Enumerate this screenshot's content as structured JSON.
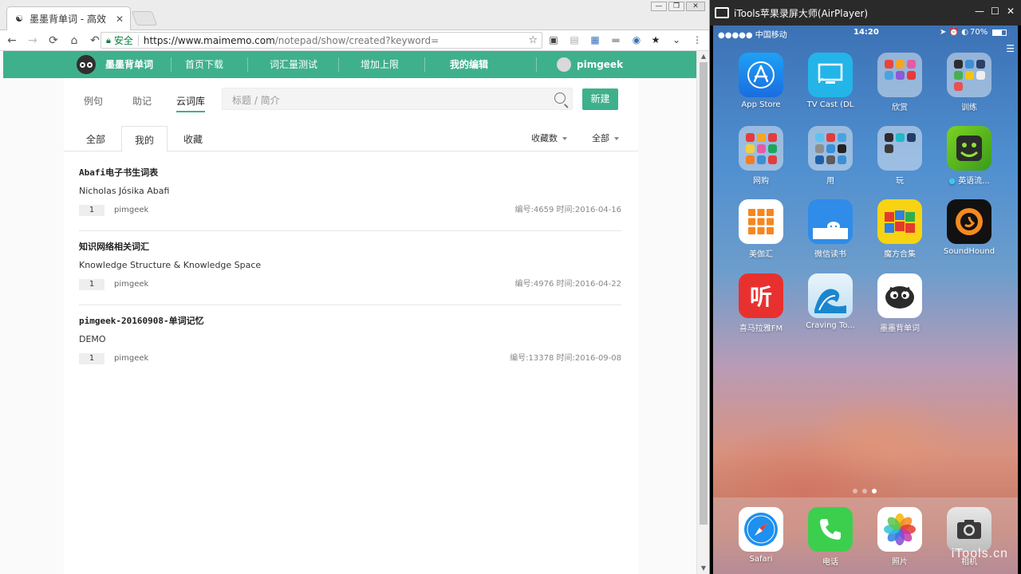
{
  "browser": {
    "tab_title": "墨墨背单词 - 高效",
    "tab_close": "✕",
    "window_controls": {
      "minimize": "—",
      "restore": "❐",
      "close": "✕"
    },
    "nav": {
      "back": "←",
      "forward": "→",
      "reload": "⟳",
      "home": "⌂",
      "undo": "↶"
    },
    "security_label": "安全",
    "url_host": "https://www.maimemo.com",
    "url_path": "/notepad/show/created?keyword=",
    "star": "☆"
  },
  "site": {
    "brand": "墨墨背单词",
    "nav_items": [
      "首页下载",
      "词汇量测试",
      "增加上限",
      "我的编辑"
    ],
    "user": "pimgeek",
    "subtabs": [
      "例句",
      "助记",
      "云词库"
    ],
    "active_subtab": "云词库",
    "search_placeholder": "标题 / 简介",
    "new_button": "新建",
    "filter_tabs": [
      "全部",
      "我的",
      "收藏"
    ],
    "sort_by": "收藏数",
    "range": "全部",
    "entries": [
      {
        "title": "Abafi电子书生词表",
        "subtitle": "Nicholas Jósika Abafi",
        "count": "1",
        "author": "pimgeek",
        "meta": "编号:4659  时间:2016-04-16"
      },
      {
        "title": "知识网络相关词汇",
        "subtitle": "Knowledge Structure & Knowledge Space",
        "count": "1",
        "author": "pimgeek",
        "meta": "编号:4976  时间:2016-04-22"
      },
      {
        "title": "pimgeek-20160908-单词记忆",
        "subtitle": "DEMO",
        "count": "1",
        "author": "pimgeek",
        "meta": "编号:13378  时间:2016-09-08"
      }
    ]
  },
  "itools": {
    "window_title": "iTools苹果录屏大师(AirPlayer)",
    "controls": {
      "minimize": "—",
      "restore": "☐",
      "close": "✕"
    },
    "status": {
      "carrier": "●●●●● 中国移动",
      "time": "14:20",
      "battery": "70%"
    },
    "apps": [
      {
        "label": "App Store"
      },
      {
        "label": "TV Cast (DL"
      },
      {
        "label": "欣赏"
      },
      {
        "label": "训练"
      },
      {
        "label": "网购"
      },
      {
        "label": "用"
      },
      {
        "label": "玩"
      },
      {
        "label": "英语流..."
      },
      {
        "label": "美伽汇"
      },
      {
        "label": "微信读书"
      },
      {
        "label": "魔方合集"
      },
      {
        "label": "SoundHound"
      },
      {
        "label": "喜马拉雅FM"
      },
      {
        "label": "Craving To..."
      },
      {
        "label": "墨墨背单词"
      }
    ],
    "dock": [
      {
        "label": "Safari"
      },
      {
        "label": "电话"
      },
      {
        "label": "照片"
      },
      {
        "label": "相机"
      }
    ],
    "watermark": "iTools.cn"
  }
}
